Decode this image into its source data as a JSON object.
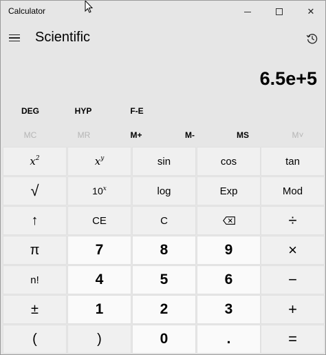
{
  "window": {
    "title": "Calculator",
    "minimize_icon": "minimize-icon",
    "maximize_icon": "maximize-icon",
    "close_glyph": "✕"
  },
  "header": {
    "mode": "Scientific",
    "menu_icon": "hamburger-icon",
    "history_icon": "history-icon"
  },
  "display": {
    "value": "6.5e+5"
  },
  "mode_buttons": [
    "DEG",
    "HYP",
    "F-E"
  ],
  "memory_buttons": [
    {
      "label": "MC",
      "enabled": false
    },
    {
      "label": "MR",
      "enabled": false
    },
    {
      "label": "M+",
      "enabled": true
    },
    {
      "label": "M-",
      "enabled": true
    },
    {
      "label": "MS",
      "enabled": true
    },
    {
      "label": "M˅",
      "enabled": false
    }
  ],
  "keys": {
    "x_squared": {
      "base": "x",
      "sup": "2"
    },
    "x_power_y": {
      "base": "x",
      "sup": "y"
    },
    "sin": "sin",
    "cos": "cos",
    "tan": "tan",
    "sqrt": "√",
    "ten_power_x": {
      "base": "10",
      "sup": "x"
    },
    "log": "log",
    "exp": "Exp",
    "mod": "Mod",
    "up_arrow": "↑",
    "ce": "CE",
    "c": "C",
    "backspace_icon": "backspace-icon",
    "divide": "÷",
    "pi": "π",
    "seven": "7",
    "eight": "8",
    "nine": "9",
    "multiply": "×",
    "factorial": "n!",
    "four": "4",
    "five": "5",
    "six": "6",
    "minus": "−",
    "plus_minus": "±",
    "one": "1",
    "two": "2",
    "three": "3",
    "plus": "+",
    "open_paren": "(",
    "close_paren": ")",
    "zero": "0",
    "decimal": ".",
    "equals": "="
  }
}
